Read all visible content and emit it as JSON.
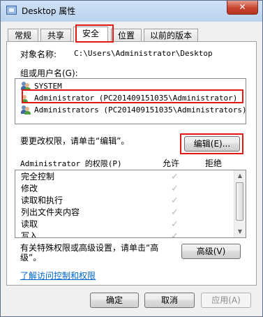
{
  "window": {
    "title": "Desktop 属性",
    "close_glyph": "✕"
  },
  "tabs": [
    {
      "label": "常规"
    },
    {
      "label": "共享"
    },
    {
      "label": "安全"
    },
    {
      "label": "位置"
    },
    {
      "label": "以前的版本"
    }
  ],
  "object": {
    "label": "对象名称:",
    "value": "C:\\Users\\Administrator\\Desktop"
  },
  "groups": {
    "label": "组或用户名(G):",
    "items": [
      {
        "name": "SYSTEM"
      },
      {
        "name": "Administrator (PC201409151035\\Administrator)"
      },
      {
        "name": "Administrators (PC201409151035\\Administrators)"
      }
    ]
  },
  "change_hint": "要更改权限，请单击“编辑”。",
  "edit_button": "编辑(E)...",
  "permissions": {
    "title": "Administrator 的权限(P)",
    "allow_header": "允许",
    "deny_header": "拒绝",
    "items": [
      {
        "name": "完全控制"
      },
      {
        "name": "修改"
      },
      {
        "name": "读取和执行"
      },
      {
        "name": "列出文件夹内容"
      },
      {
        "name": "读取"
      },
      {
        "name": "写入"
      }
    ],
    "check_glyph": "✓"
  },
  "advanced": {
    "hint": "有关特殊权限或高级设置，请单击“高级”。",
    "button": "高级(V)"
  },
  "learn_link": "了解访问控制和权限",
  "footer": {
    "ok": "确定",
    "cancel": "取消",
    "apply": "应用(A)"
  },
  "colors": {
    "highlight": "#e01818",
    "link": "#0066cc"
  }
}
